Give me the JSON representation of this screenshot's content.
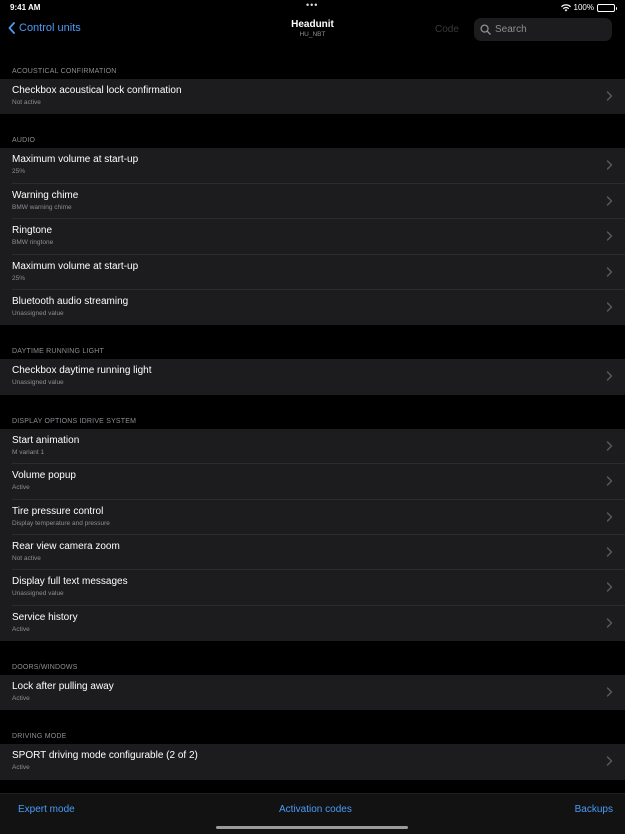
{
  "status": {
    "time": "9:41 AM",
    "dots": "•••",
    "battery_text": "100%",
    "battery_level": 1.0
  },
  "nav": {
    "back_label": "Control units",
    "title": "Headunit",
    "subtitle": "HU_NBT",
    "code_label": "Code",
    "search_placeholder": "Search"
  },
  "colors": {
    "accent": "#4a9bf7",
    "background": "#000000",
    "cell": "#1c1c1e",
    "secondary_text": "#8e8e93"
  },
  "sections": [
    {
      "header": "ACOUSTICAL CONFIRMATION",
      "rows": [
        {
          "title": "Checkbox acoustical lock confirmation",
          "subtitle": "Not active"
        }
      ]
    },
    {
      "header": "AUDIO",
      "rows": [
        {
          "title": "Maximum volume at start-up",
          "subtitle": "25%"
        },
        {
          "title": "Warning chime",
          "subtitle": "BMW warning chime"
        },
        {
          "title": "Ringtone",
          "subtitle": "BMW ringtone"
        },
        {
          "title": "Maximum volume at start-up",
          "subtitle": "25%"
        },
        {
          "title": "Bluetooth audio streaming",
          "subtitle": "Unassigned value"
        }
      ]
    },
    {
      "header": "DAYTIME RUNNING LIGHT",
      "rows": [
        {
          "title": "Checkbox daytime running light",
          "subtitle": "Unassigned value"
        }
      ]
    },
    {
      "header": "DISPLAY OPTIONS IDRIVE SYSTEM",
      "rows": [
        {
          "title": "Start animation",
          "subtitle": "M variant 1"
        },
        {
          "title": "Volume popup",
          "subtitle": "Active"
        },
        {
          "title": "Tire pressure control",
          "subtitle": "Display temperature and pressure"
        },
        {
          "title": "Rear view camera zoom",
          "subtitle": "Not active"
        },
        {
          "title": "Display full text messages",
          "subtitle": "Unassigned value"
        },
        {
          "title": "Service history",
          "subtitle": "Active"
        }
      ]
    },
    {
      "header": "DOORS/WINDOWS",
      "rows": [
        {
          "title": "Lock after pulling away",
          "subtitle": "Active"
        }
      ]
    },
    {
      "header": "DRIVING MODE",
      "rows": [
        {
          "title": "SPORT driving mode configurable (2 of 2)",
          "subtitle": "Active"
        }
      ]
    }
  ],
  "bottom": {
    "left_label": "Expert mode",
    "center_label": "Activation codes",
    "right_label": "Backups"
  }
}
